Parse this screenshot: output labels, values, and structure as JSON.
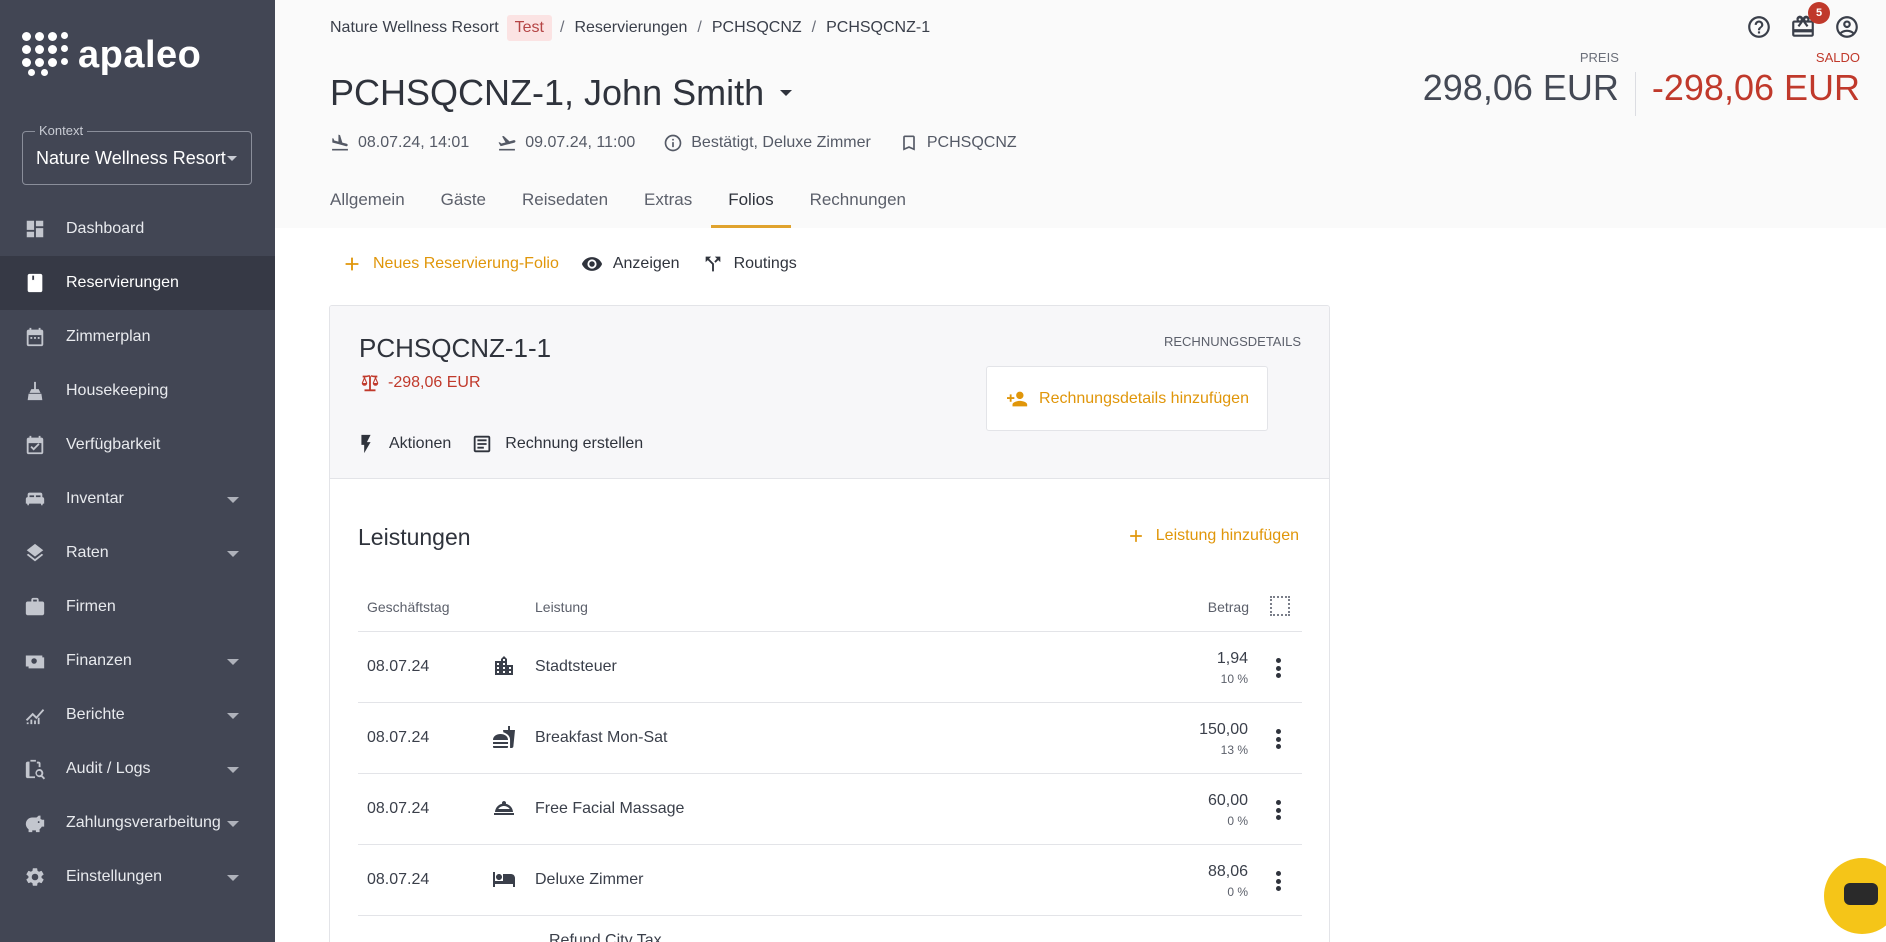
{
  "app": {
    "logo_text": "apaleo",
    "context_label": "Kontext",
    "context_value": "Nature Wellness Resort"
  },
  "sidebar": {
    "items": [
      {
        "label": "Dashboard",
        "icon": "dashboard-icon",
        "active": false,
        "expandable": false
      },
      {
        "label": "Reservierungen",
        "icon": "book-icon",
        "active": true,
        "expandable": false
      },
      {
        "label": "Zimmerplan",
        "icon": "calendar-icon",
        "active": false,
        "expandable": false
      },
      {
        "label": "Housekeeping",
        "icon": "broom-icon",
        "active": false,
        "expandable": false
      },
      {
        "label": "Verfügbarkeit",
        "icon": "calendar-check-icon",
        "active": false,
        "expandable": false
      },
      {
        "label": "Inventar",
        "icon": "bed-icon",
        "active": false,
        "expandable": true
      },
      {
        "label": "Raten",
        "icon": "layers-icon",
        "active": false,
        "expandable": true
      },
      {
        "label": "Firmen",
        "icon": "briefcase-icon",
        "active": false,
        "expandable": false
      },
      {
        "label": "Finanzen",
        "icon": "money-icon",
        "active": false,
        "expandable": true
      },
      {
        "label": "Berichte",
        "icon": "chart-icon",
        "active": false,
        "expandable": true
      },
      {
        "label": "Audit / Logs",
        "icon": "audit-icon",
        "active": false,
        "expandable": true
      },
      {
        "label": "Zahlungsverarbeitung",
        "icon": "piggy-bank-icon",
        "active": false,
        "expandable": true
      },
      {
        "label": "Einstellungen",
        "icon": "gear-icon",
        "active": false,
        "expandable": true
      }
    ]
  },
  "header": {
    "breadcrumb": {
      "property": "Nature Wellness Resort",
      "badge": "Test",
      "reservations": "Reservierungen",
      "booking": "PCHSQCNZ",
      "reservation": "PCHSQCNZ-1"
    },
    "notification_count": "5",
    "title": "PCHSQCNZ-1, John Smith",
    "price_label": "PREIS",
    "price_value": "298,06 EUR",
    "saldo_label": "SALDO",
    "saldo_value": "-298,06 EUR",
    "arrival": "08.07.24, 14:01",
    "departure": "09.07.24, 11:00",
    "status": "Bestätigt, Deluxe Zimmer",
    "booking_ref": "PCHSQCNZ",
    "tabs": [
      {
        "label": "Allgemein",
        "active": false
      },
      {
        "label": "Gäste",
        "active": false
      },
      {
        "label": "Reisedaten",
        "active": false
      },
      {
        "label": "Extras",
        "active": false
      },
      {
        "label": "Folios",
        "active": true
      },
      {
        "label": "Rechnungen",
        "active": false
      }
    ]
  },
  "actions": {
    "new_folio": "Neues Reservierung-Folio",
    "show": "Anzeigen",
    "routings": "Routings"
  },
  "folio": {
    "id": "PCHSQCNZ-1-1",
    "balance": "-298,06 EUR",
    "actions_label": "Aktionen",
    "create_invoice": "Rechnung erstellen",
    "invoice_details_label": "RECHNUNGSDETAILS",
    "add_invoice_details": "Rechnungsdetails hinzufügen",
    "services_title": "Leistungen",
    "add_service": "Leistung hinzufügen",
    "columns": {
      "date": "Geschäftstag",
      "service": "Leistung",
      "amount": "Betrag"
    },
    "rows": [
      {
        "date": "08.07.24",
        "icon": "city-icon",
        "name": "Stadtsteuer",
        "amount": "1,94",
        "vat": "10 %"
      },
      {
        "date": "08.07.24",
        "icon": "food-icon",
        "name": "Breakfast Mon-Sat",
        "amount": "150,00",
        "vat": "13 %"
      },
      {
        "date": "08.07.24",
        "icon": "room-service-icon",
        "name": "Free Facial Massage",
        "amount": "60,00",
        "vat": "0 %"
      },
      {
        "date": "08.07.24",
        "icon": "bed-icon",
        "name": "Deluxe Zimmer",
        "amount": "88,06",
        "vat": "0 %"
      }
    ],
    "partial_row_name": "Refund City Tax"
  },
  "colors": {
    "sidebar": "#424654",
    "accent": "#e0a32e",
    "negative": "#c0392b",
    "chat": "#f5c518"
  }
}
